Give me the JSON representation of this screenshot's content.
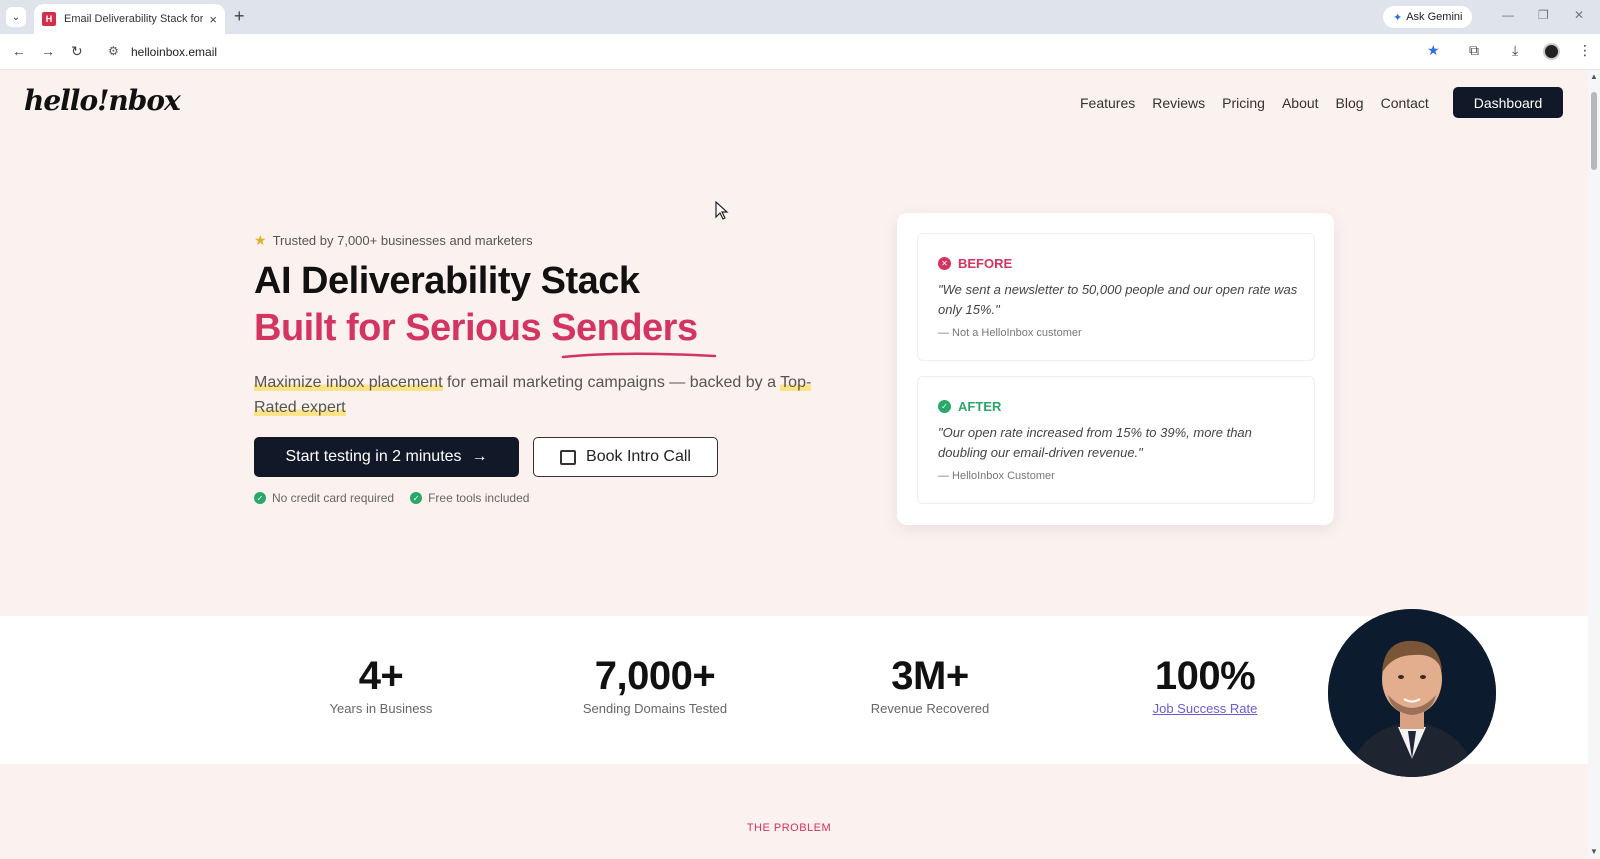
{
  "browser": {
    "tab_title": "Email Deliverability Stack for Se",
    "tab_favicon": "H",
    "new_tab_glyph": "+",
    "gemini_label": "Ask Gemini",
    "url": "helloinbox.email"
  },
  "header": {
    "logo": "hello!nbox",
    "nav": [
      "Features",
      "Reviews",
      "Pricing",
      "About",
      "Blog",
      "Contact"
    ],
    "dashboard_label": "Dashboard"
  },
  "hero": {
    "trusted": "Trusted by 7,000+ businesses and marketers",
    "title_line1": "AI Deliverability Stack",
    "title_line2": "Built for Serious Senders",
    "subtitle_hl1": "Maximize inbox placement",
    "subtitle_mid": " for email marketing campaigns — backed by a ",
    "subtitle_hl2": "Top-Rated expert",
    "cta_primary": "Start testing in 2 minutes",
    "cta_secondary": "Book Intro Call",
    "checks": [
      "No credit card required",
      "Free tools included"
    ]
  },
  "testimonial_card": {
    "before": {
      "label": "BEFORE",
      "text": "\"We sent a newsletter to 50,000 people and our open rate was only 15%.\"",
      "by": "— Not a HelloInbox customer"
    },
    "after": {
      "label": "AFTER",
      "text": "\"Our open rate increased from 15% to 39%, more than doubling our email-driven revenue.\"",
      "by": "— HelloInbox Customer"
    }
  },
  "stats": [
    {
      "value": "4+",
      "label": "Years in Business"
    },
    {
      "value": "7,000+",
      "label": "Sending Domains Tested"
    },
    {
      "value": "3M+",
      "label": "Revenue Recovered"
    },
    {
      "value": "100%",
      "label": "Job Success Rate"
    }
  ],
  "section_problem": "THE PROBLEM",
  "colors": {
    "accent": "#d43460",
    "dark": "#111827",
    "success": "#2aa86a",
    "page_bg": "#fbf1ee",
    "link": "#6b5bd6"
  },
  "icons": [
    "star-icon",
    "arrow-right-icon",
    "calendar-icon",
    "check-circle-icon",
    "x-circle-icon"
  ]
}
